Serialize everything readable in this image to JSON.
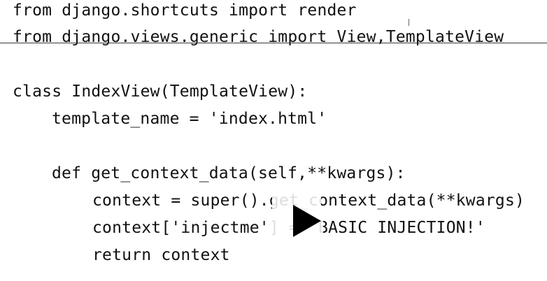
{
  "code_lines": [
    "from django.shortcuts import render",
    "from django.views.generic import View,TemplateView",
    "class IndexView(TemplateView):",
    "template_name = 'index.html'",
    "def get_context_data(self,**kwargs):",
    "context = super().get_context_data(**kwargs)",
    "context['injectme'] = 'BASIC INJECTION!'",
    "return context"
  ],
  "video": {
    "play_icon": "play-icon"
  }
}
